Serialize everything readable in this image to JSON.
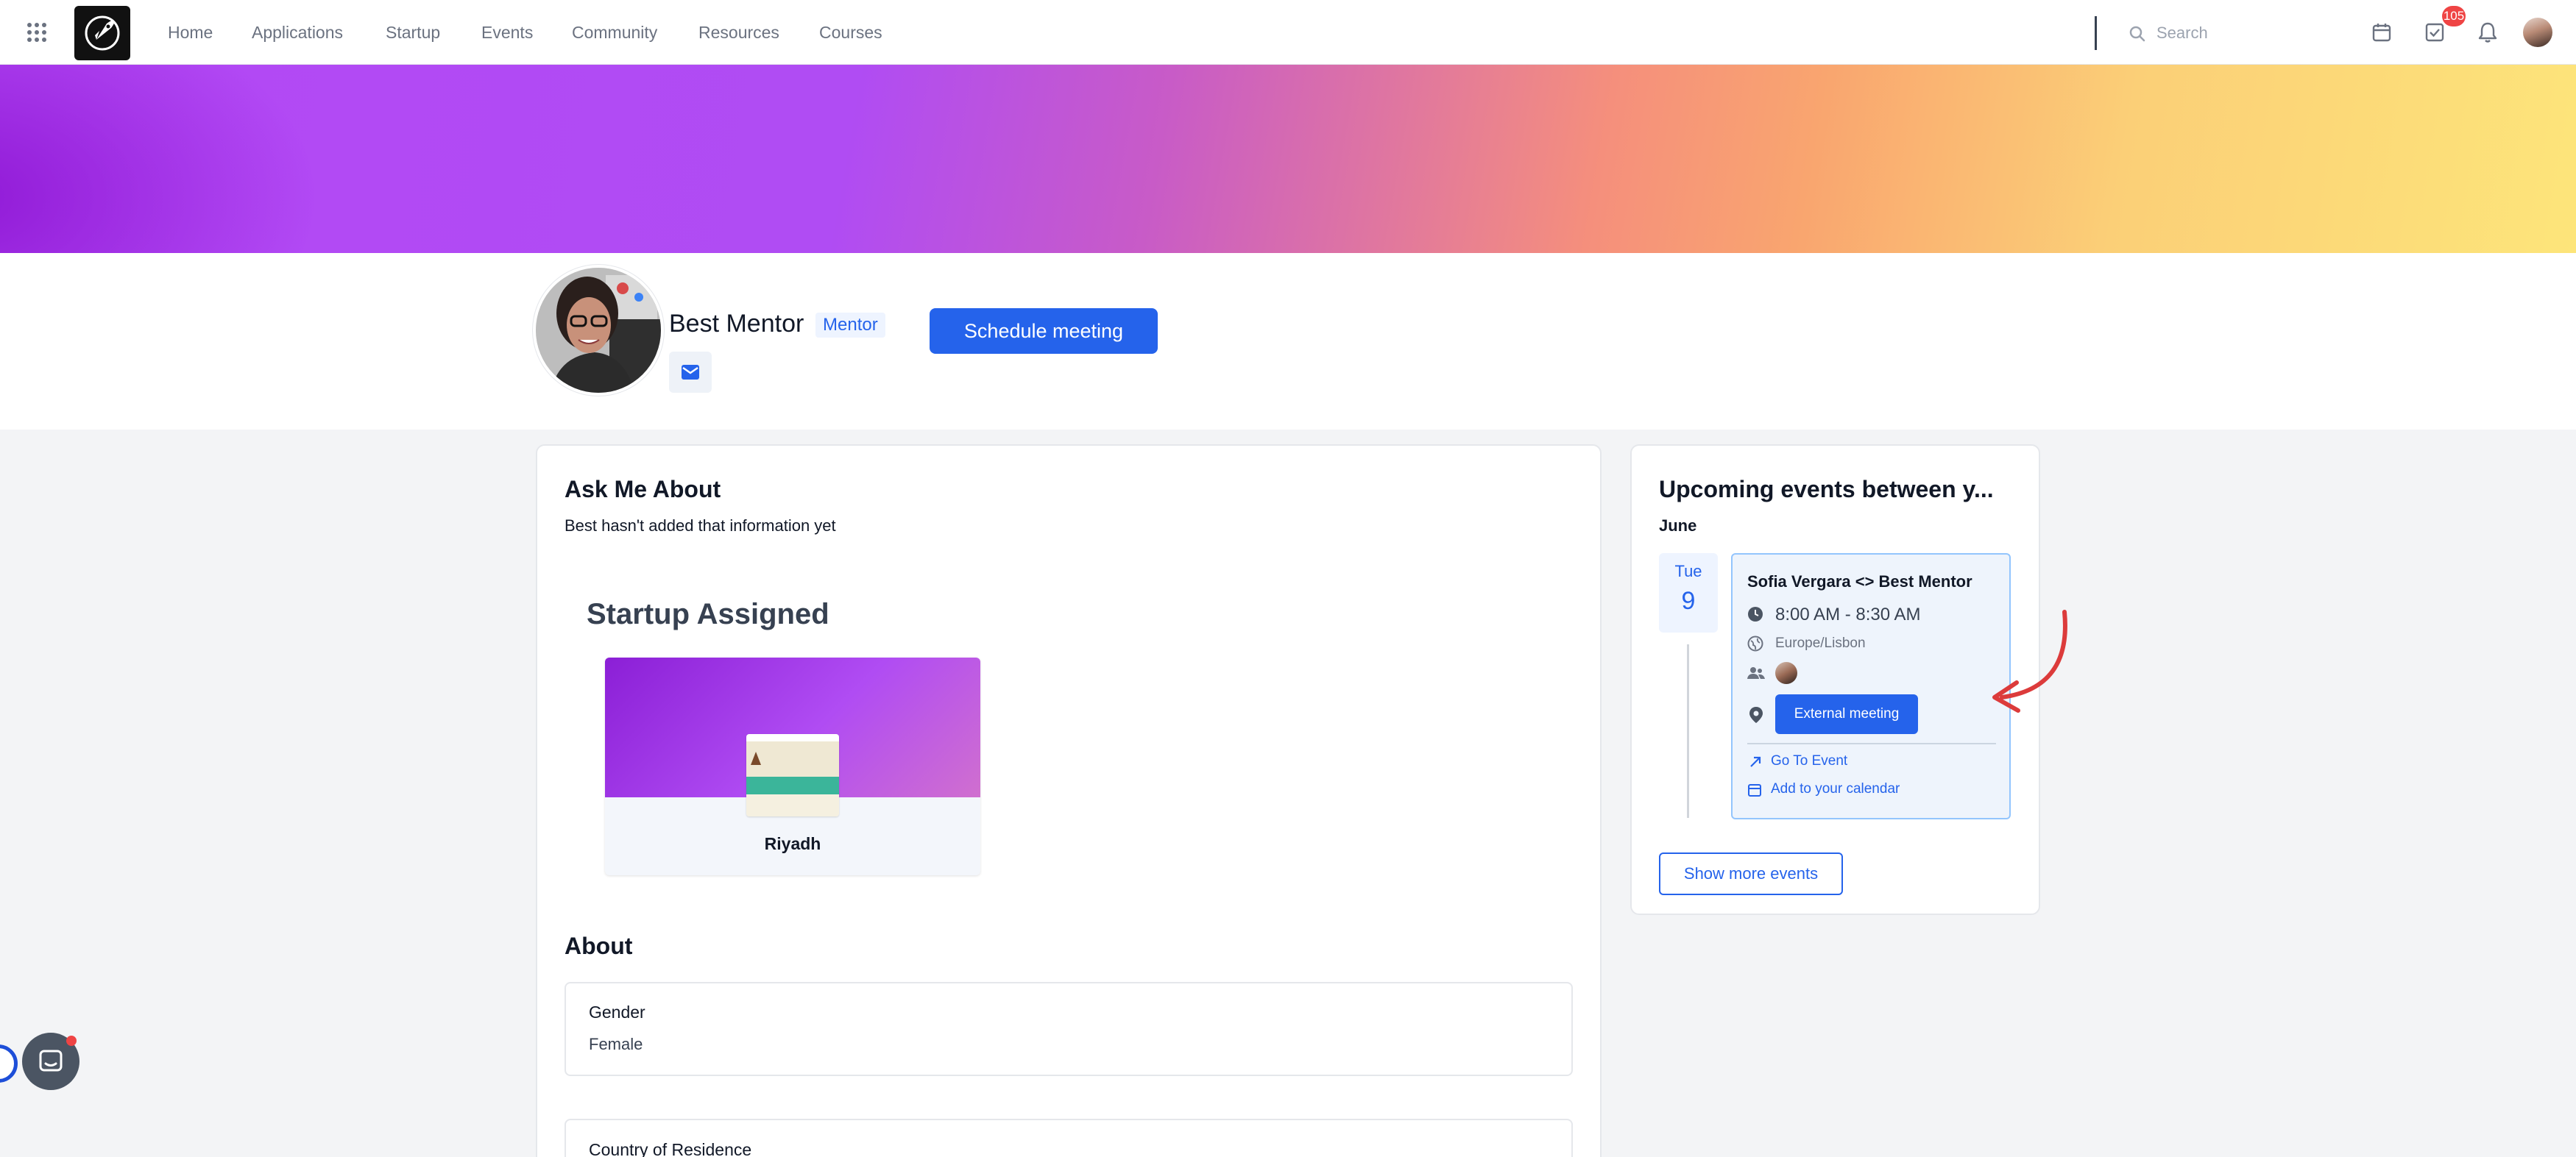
{
  "nav": {
    "links": [
      "Home",
      "Applications",
      "Startup",
      "Events",
      "Community",
      "Resources",
      "Courses"
    ],
    "search_placeholder": "Search",
    "notification_count": "105"
  },
  "profile": {
    "name": "Best Mentor",
    "role_badge": "Mentor",
    "schedule_button": "Schedule meeting"
  },
  "ask_me_about": {
    "title": "Ask Me About",
    "empty_text": "Best hasn't added that information yet"
  },
  "startup_assigned": {
    "title": "Startup Assigned",
    "startup_name": "Riyadh"
  },
  "about": {
    "title": "About",
    "fields": [
      {
        "label": "Gender",
        "value": "Female"
      },
      {
        "label": "Country of Residence",
        "value": ""
      }
    ]
  },
  "upcoming": {
    "title": "Upcoming events between y...",
    "month": "June",
    "event": {
      "weekday": "Tue",
      "day": "9",
      "title": "Sofia Vergara <> Best Mentor",
      "time": "8:00 AM - 8:30 AM",
      "timezone": "Europe/Lisbon",
      "location_button": "External meeting",
      "go_to_event": "Go To Event",
      "add_to_calendar": "Add to your calendar"
    },
    "show_more": "Show more events"
  },
  "colors": {
    "primary": "#2563eb",
    "annotation_arrow": "#dc3b3b",
    "badge_red": "#ef4444"
  }
}
